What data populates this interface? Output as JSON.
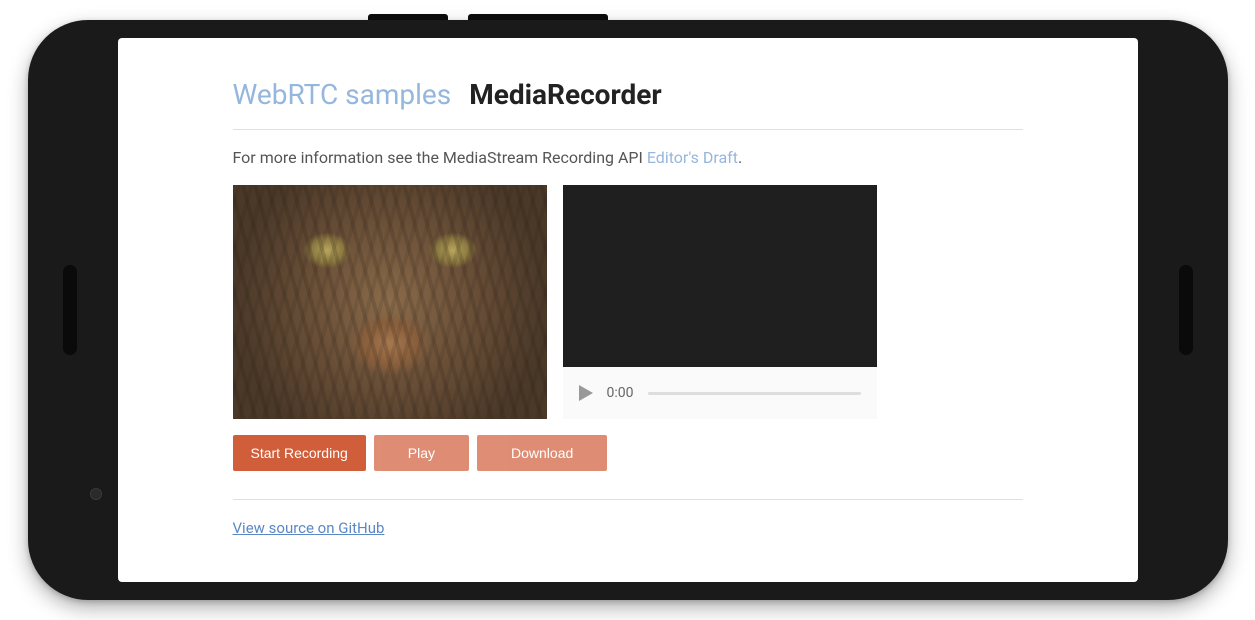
{
  "header": {
    "link_text": "WebRTC samples",
    "title": "MediaRecorder"
  },
  "description": {
    "prefix": "For more information see the MediaStream Recording API ",
    "link_text": "Editor's Draft",
    "suffix": "."
  },
  "video_player": {
    "time": "0:00"
  },
  "buttons": {
    "start_recording": "Start Recording",
    "play": "Play",
    "download": "Download"
  },
  "footer": {
    "source_link": "View source on GitHub"
  }
}
